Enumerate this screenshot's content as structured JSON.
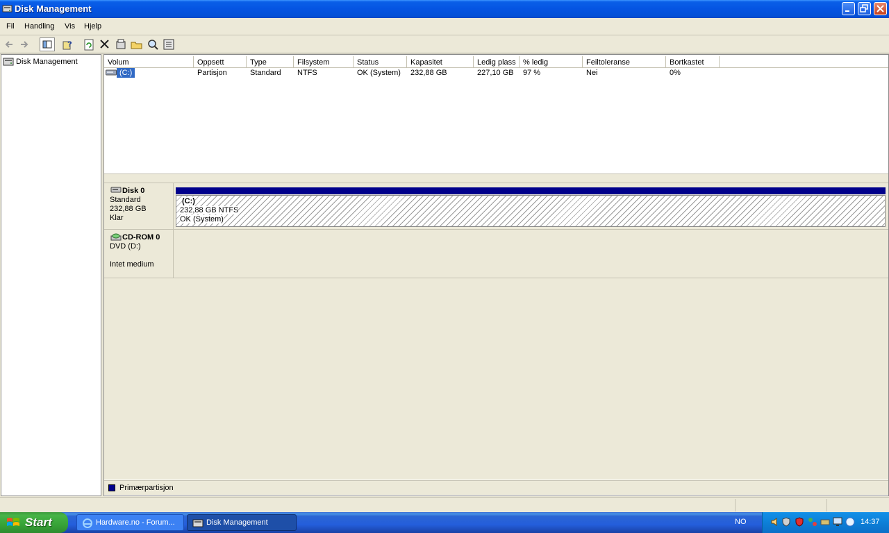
{
  "window": {
    "title": "Disk Management"
  },
  "menu": [
    "Fil",
    "Handling",
    "Vis",
    "Hjelp"
  ],
  "toolbar_icons": [
    "back-icon",
    "forward-icon",
    "show-hide-tree-icon",
    "help-icon",
    "refresh-icon",
    "delete-icon",
    "properties-icon",
    "open-icon",
    "rescan-icon",
    "settings-icon"
  ],
  "tree": {
    "root_label": "Disk Management"
  },
  "list": {
    "columns": [
      "Volum",
      "Oppsett",
      "Type",
      "Filsystem",
      "Status",
      "Kapasitet",
      "Ledig plass",
      "% ledig",
      "Feiltoleranse",
      "Bortkastet"
    ],
    "rows": [
      {
        "volum": "(C:)",
        "oppsett": "Partisjon",
        "type": "Standard",
        "filsystem": "NTFS",
        "status": "OK (System)",
        "kapasitet": "232,88 GB",
        "ledig": "227,10 GB",
        "prosent": "97 %",
        "feiltoleranse": "Nei",
        "bortkastet": "0%"
      }
    ]
  },
  "disks": [
    {
      "name": "Disk 0",
      "type": "Standard",
      "size": "232,88 GB",
      "state": "Klar",
      "partition": {
        "label": "(C:)",
        "size_fs": "232,88 GB NTFS",
        "status": "OK (System)"
      }
    },
    {
      "name": "CD-ROM 0",
      "type": "DVD (D:)",
      "state": "Intet medium"
    }
  ],
  "legend": {
    "primary_label": "Primærpartisjon",
    "primary_color": "#00008b"
  },
  "taskbar": {
    "start_label": "Start",
    "tasks": [
      "Hardware.no - Forum...",
      "Disk Management"
    ],
    "language": "NO",
    "clock": "14:37"
  }
}
